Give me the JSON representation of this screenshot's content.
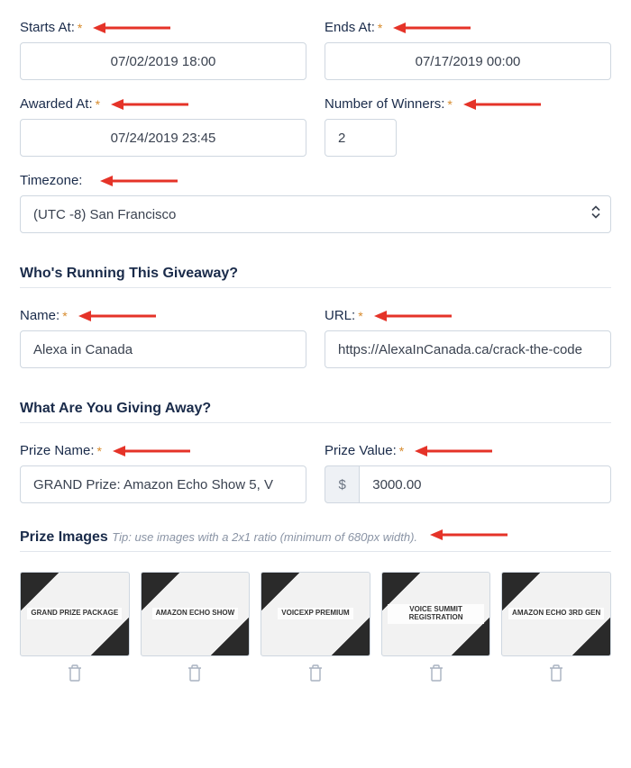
{
  "schedule": {
    "startsAt": {
      "label": "Starts At:",
      "value": "07/02/2019 18:00"
    },
    "endsAt": {
      "label": "Ends At:",
      "value": "07/17/2019 00:00"
    },
    "awardedAt": {
      "label": "Awarded At:",
      "value": "07/24/2019 23:45"
    },
    "winners": {
      "label": "Number of Winners:",
      "value": "2"
    },
    "timezone": {
      "label": "Timezone:",
      "value": "(UTC -8) San Francisco"
    }
  },
  "sponsor": {
    "heading": "Who's Running This Giveaway?",
    "name": {
      "label": "Name:",
      "value": "Alexa in Canada"
    },
    "url": {
      "label": "URL:",
      "value": "https://AlexaInCanada.ca/crack-the-code"
    }
  },
  "prize": {
    "heading": "What Are You Giving Away?",
    "name": {
      "label": "Prize Name:",
      "value": "GRAND Prize: Amazon Echo Show 5, V"
    },
    "value": {
      "label": "Prize Value:",
      "currency": "$",
      "amount": "3000.00"
    }
  },
  "prizeImages": {
    "heading": "Prize Images",
    "tip": "Tip: use images with a 2x1 ratio (minimum of 680px width).",
    "items": [
      {
        "caption": "GRAND PRIZE PACKAGE"
      },
      {
        "caption": "AMAZON ECHO SHOW"
      },
      {
        "caption": "VOICEXP PREMIUM"
      },
      {
        "caption": "VOICE SUMMIT REGISTRATION"
      },
      {
        "caption": "AMAZON ECHO 3RD GEN"
      }
    ]
  },
  "arrowColor": "#e53328"
}
